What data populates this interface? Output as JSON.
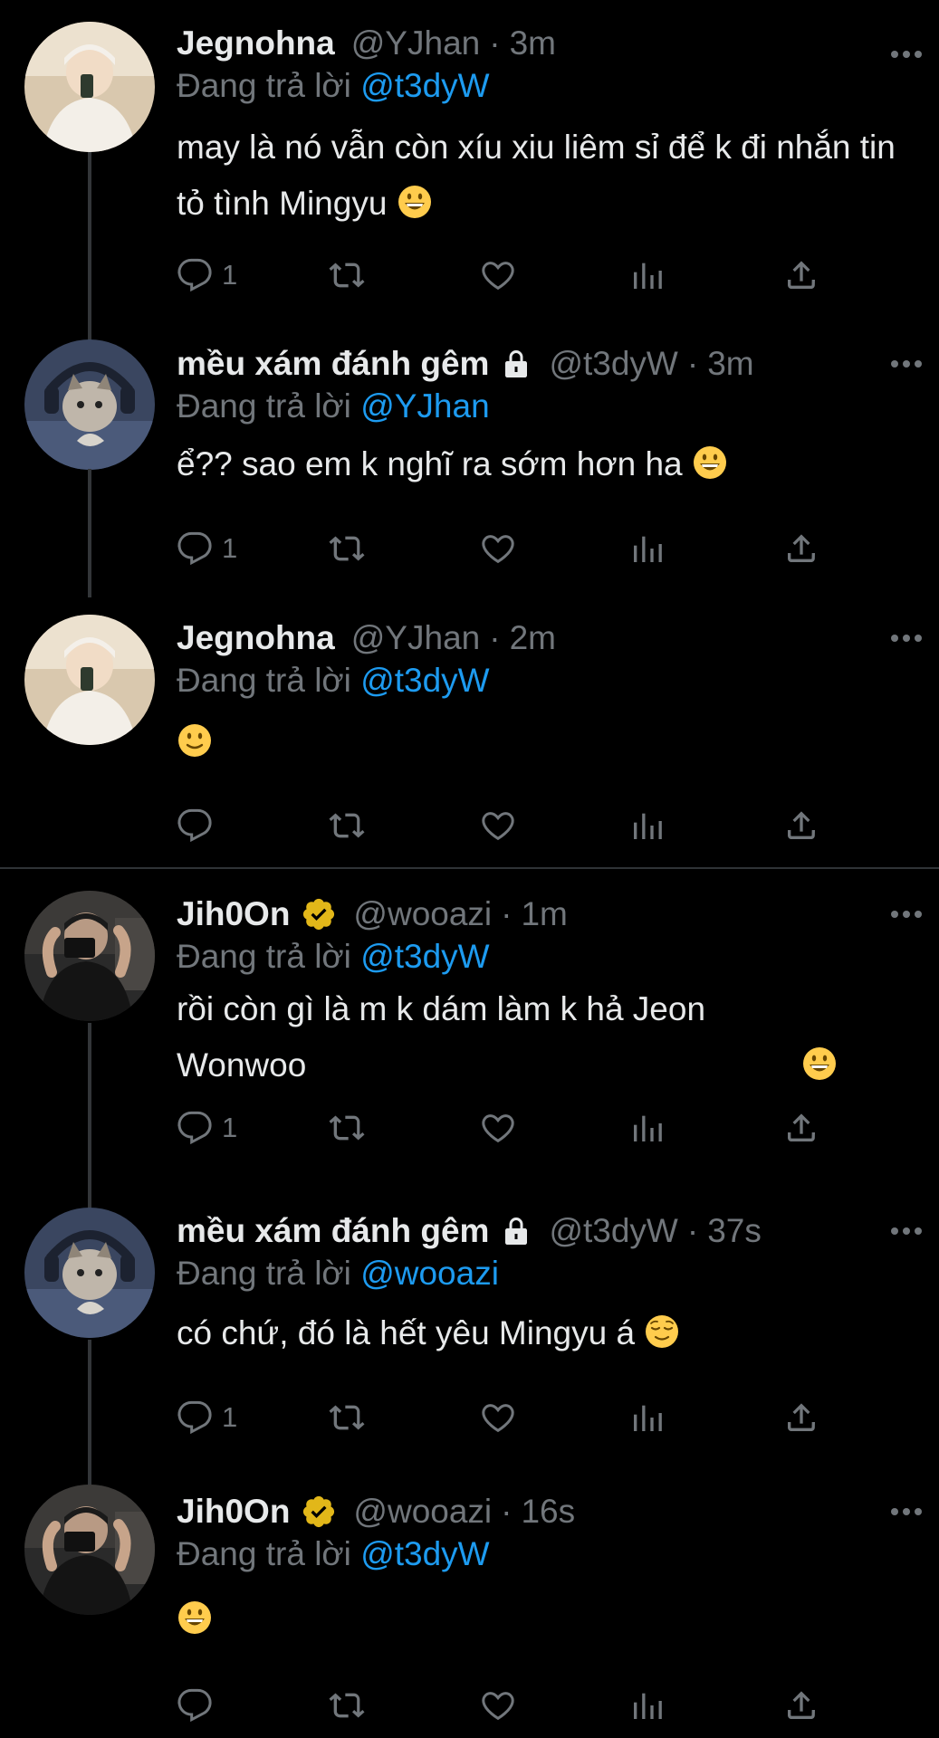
{
  "reply_prefix": "Đang trả lời ",
  "tweets": [
    {
      "name": "Jegnohna",
      "handle": "@YJhan",
      "time": "3m",
      "reply_to": "@t3dyW",
      "text": "may là nó vẫn còn xíu xiu liêm sỉ để k đi nhắn tin tỏ tình Mingyu",
      "emoji": "grinning",
      "reply_count": "1"
    },
    {
      "name": "mều xám đánh gêm",
      "handle": "@t3dyW",
      "time": "3m",
      "reply_to": "@YJhan",
      "text": "ể?? sao em k nghĩ ra sớm hơn ha",
      "emoji": "grinning",
      "reply_count": "1"
    },
    {
      "name": "Jegnohna",
      "handle": "@YJhan",
      "time": "2m",
      "reply_to": "@t3dyW",
      "text": "",
      "emoji": "slight-smile",
      "reply_count": ""
    },
    {
      "name": "Jih0On",
      "handle": "@wooazi",
      "time": "1m",
      "reply_to": "@t3dyW",
      "text": "rồi còn gì là m k dám làm k hả Jeon Wonwoo",
      "emoji": "grinning",
      "reply_count": "1"
    },
    {
      "name": "mều xám đánh gêm",
      "handle": "@t3dyW",
      "time": "37s",
      "reply_to": "@wooazi",
      "text": "có chứ, đó là hết yêu Mingyu á",
      "emoji": "relieved",
      "reply_count": "1"
    },
    {
      "name": "Jih0On",
      "handle": "@wooazi",
      "time": "16s",
      "reply_to": "@t3dyW",
      "text": "",
      "emoji": "grinning",
      "reply_count": ""
    }
  ],
  "colors": {
    "background": "#000000",
    "muted": "#71767b",
    "link": "#1d9bf0",
    "verified_gold": "#e2b719"
  },
  "icons": {
    "reply": "reply-icon",
    "retweet": "retweet-icon",
    "like": "heart-icon",
    "views": "views-icon",
    "share": "share-icon",
    "more": "more-icon",
    "lock": "lock-icon",
    "verified": "verified-badge-icon"
  }
}
